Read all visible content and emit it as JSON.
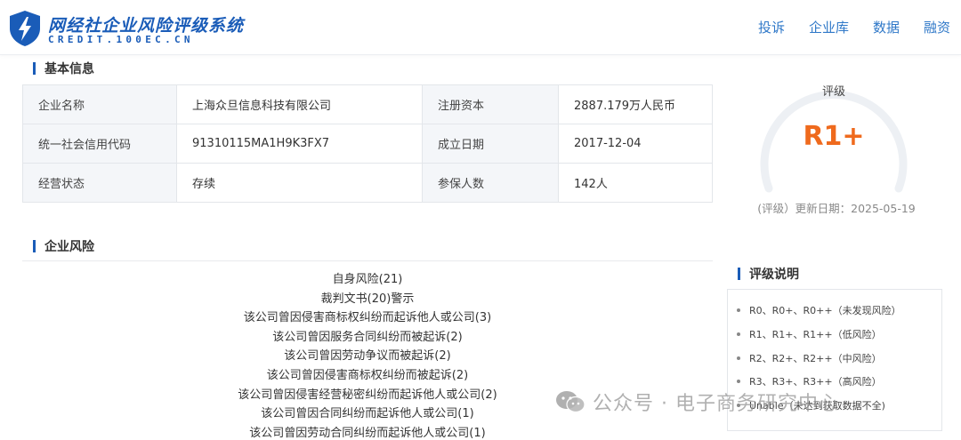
{
  "header": {
    "logo_title": "网经社企业风险评级系统",
    "logo_subtitle": "CREDIT.100EC.CN",
    "nav": [
      "投诉",
      "企业库",
      "数据",
      "融资"
    ]
  },
  "basic_info": {
    "title": "基本信息",
    "rows": [
      [
        "企业名称",
        "上海众旦信息科技有限公司",
        "注册资本",
        "2887.179万人民币"
      ],
      [
        "统一社会信用代码",
        "91310115MA1H9K3FX7",
        "成立日期",
        "2017-12-04"
      ],
      [
        "经营状态",
        "存续",
        "参保人数",
        "142人"
      ]
    ]
  },
  "risk": {
    "title": "企业风险",
    "items": [
      "自身风险(21)",
      "裁判文书(20)警示",
      "该公司曾因侵害商标权纠纷而起诉他人或公司(3)",
      "该公司曾因服务合同纠纷而被起诉(2)",
      "该公司曾因劳动争议而被起诉(2)",
      "该公司曾因侵害商标权纠纷而被起诉(2)",
      "该公司曾因侵害经营秘密纠纷而起诉他人或公司(2)",
      "该公司曾因合同纠纷而起诉他人或公司(1)",
      "该公司曾因劳动合同纠纷而起诉他人或公司(1)"
    ]
  },
  "rating": {
    "label": "评级",
    "value": "R1+",
    "updated": "(评级）更新日期：2025-05-19",
    "accent_color": "#ef6a1d"
  },
  "rating_explain": {
    "title": "评级说明",
    "items": [
      "R0、R0+、R0++（未发现风险）",
      "R1、R1+、R1++（低风险）",
      "R2、R2+、R2++（中风险）",
      "R3、R3+、R3++（高风险）",
      "Unable（未达到获取数据不全)"
    ]
  },
  "watermark": "公众号 · 电子商务研究中心"
}
